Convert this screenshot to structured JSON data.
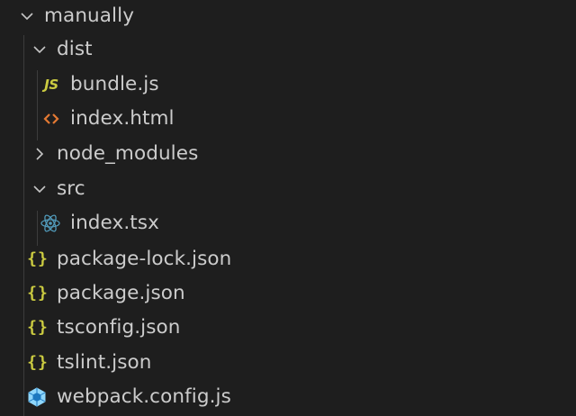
{
  "explorer": {
    "items": [
      {
        "name": "manually",
        "type": "folder",
        "expanded": true,
        "icon": "chevron-down-icon"
      },
      {
        "name": "dist",
        "type": "folder",
        "expanded": true,
        "icon": "chevron-down-icon"
      },
      {
        "name": "bundle.js",
        "type": "file",
        "icon": "javascript-file-icon",
        "glyph": "JS",
        "color": "#cbcb41"
      },
      {
        "name": "index.html",
        "type": "file",
        "icon": "html-file-icon",
        "color": "#e37933"
      },
      {
        "name": "node_modules",
        "type": "folder",
        "expanded": false,
        "icon": "chevron-right-icon"
      },
      {
        "name": "src",
        "type": "folder",
        "expanded": true,
        "icon": "chevron-down-icon"
      },
      {
        "name": "index.tsx",
        "type": "file",
        "icon": "react-file-icon",
        "color": "#519aba"
      },
      {
        "name": "package-lock.json",
        "type": "file",
        "icon": "json-file-icon",
        "glyph": "{}",
        "color": "#cbcb41"
      },
      {
        "name": "package.json",
        "type": "file",
        "icon": "json-file-icon",
        "glyph": "{}",
        "color": "#cbcb41"
      },
      {
        "name": "tsconfig.json",
        "type": "file",
        "icon": "json-file-icon",
        "glyph": "{}",
        "color": "#cbcb41"
      },
      {
        "name": "tslint.json",
        "type": "file",
        "icon": "json-file-icon",
        "glyph": "{}",
        "color": "#cbcb41"
      },
      {
        "name": "webpack.config.js",
        "type": "file",
        "icon": "webpack-file-icon",
        "color": "#8ed6fb"
      }
    ]
  }
}
